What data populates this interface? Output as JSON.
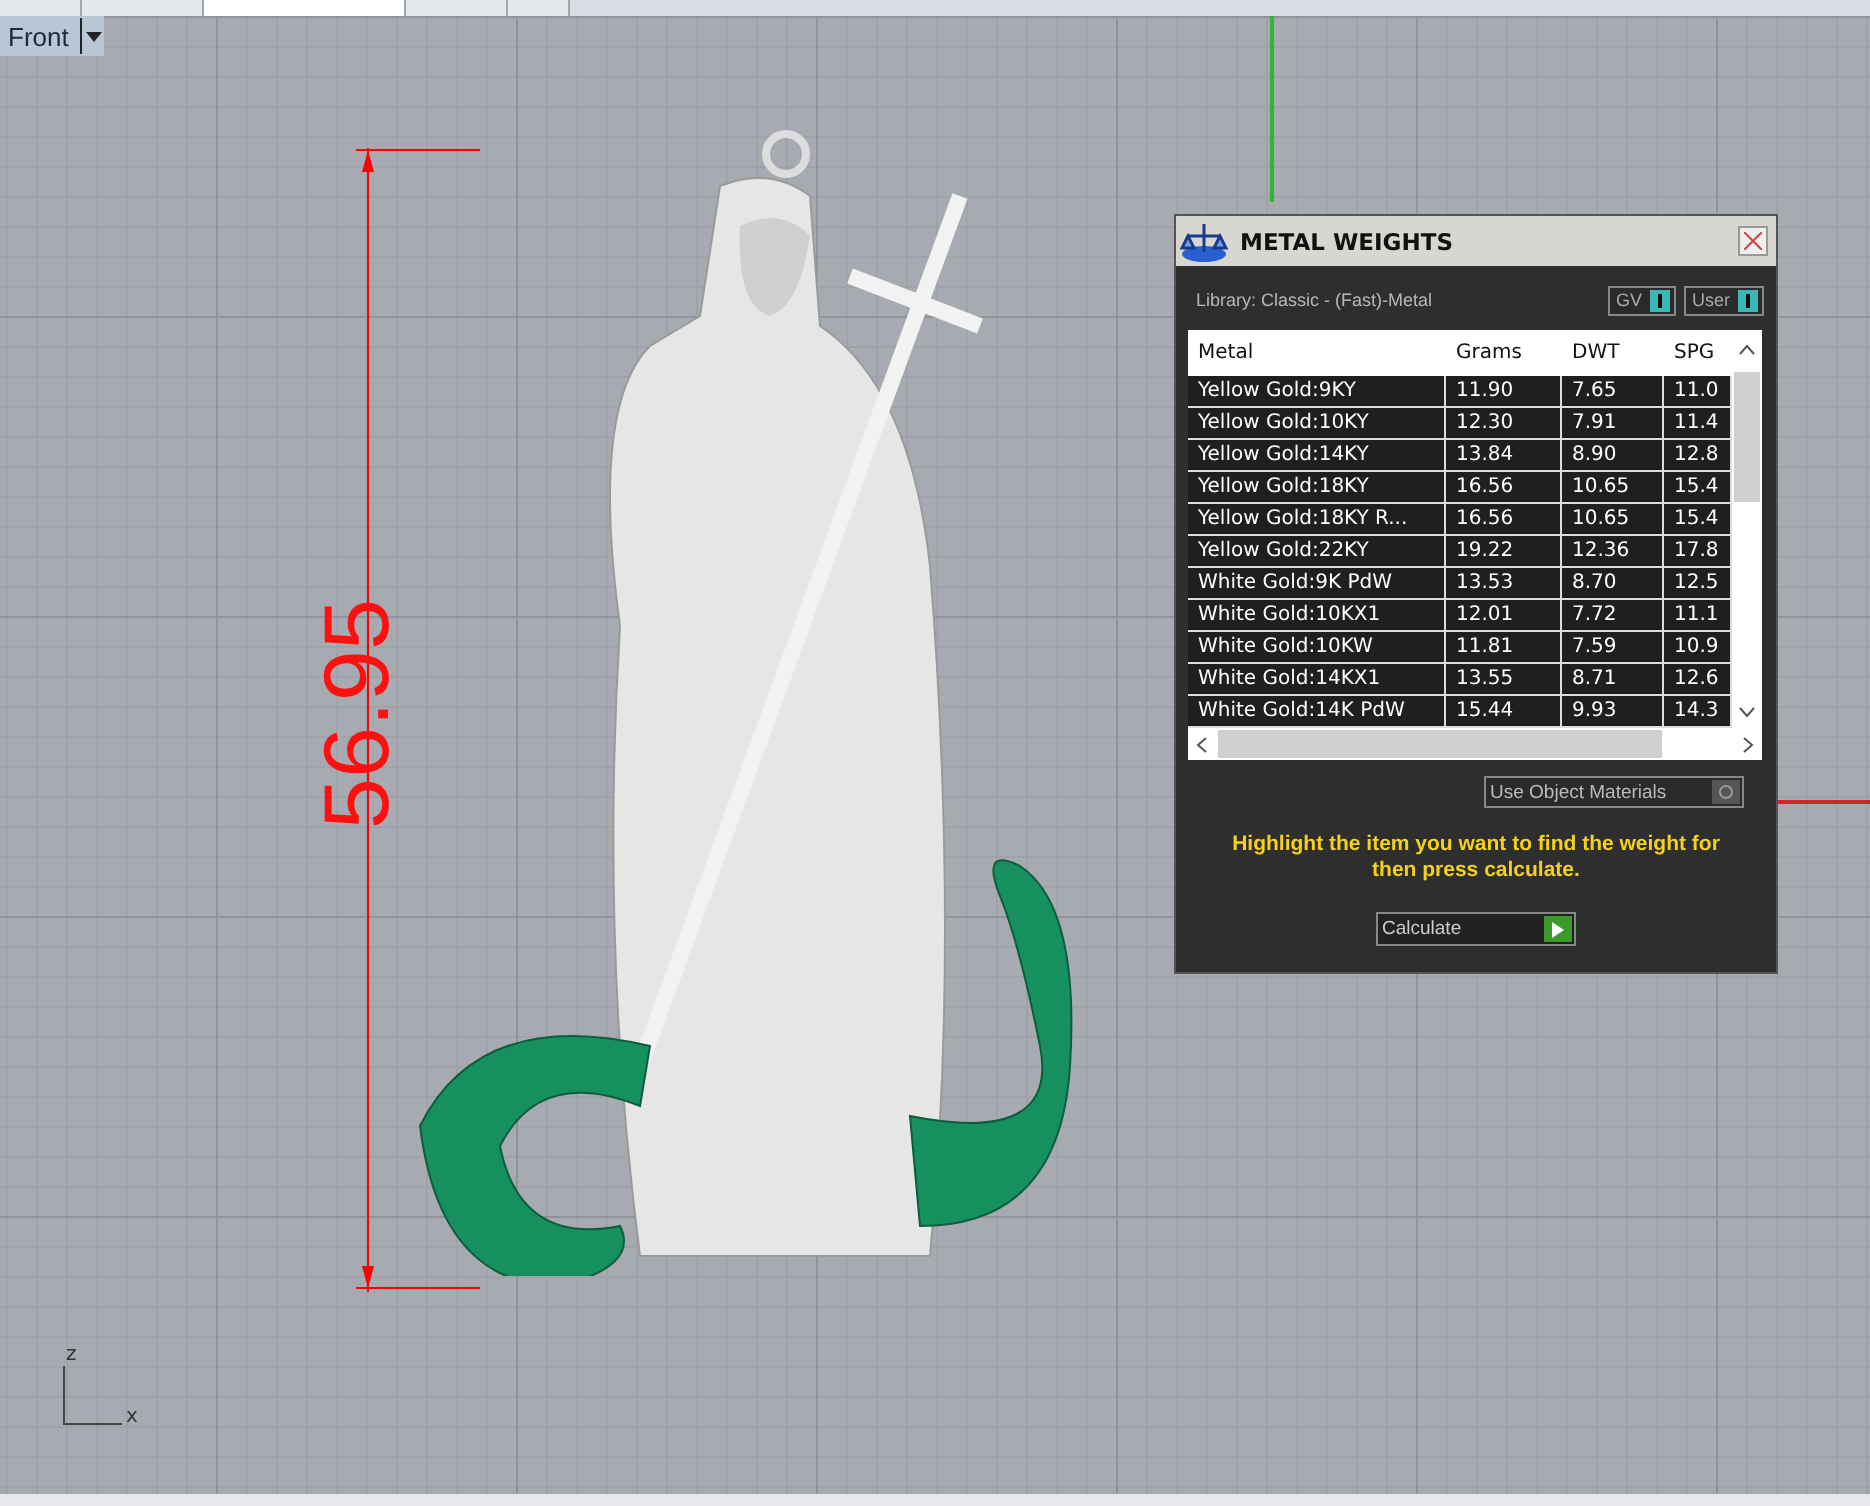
{
  "tabs": [
    {
      "selected": false
    },
    {
      "selected": false
    },
    {
      "selected": true
    },
    {
      "selected": false
    },
    {
      "selected": false
    }
  ],
  "viewport": {
    "title": "Front",
    "dimension": "56.95",
    "axes": {
      "vertical": "z",
      "horizontal": "x"
    }
  },
  "panel": {
    "title": "METAL WEIGHTS",
    "library": "Library: Classic - (Fast)-Metal",
    "toggles": [
      {
        "label": "GV",
        "on": true
      },
      {
        "label": "User",
        "on": true
      }
    ],
    "columns": [
      "Metal",
      "Grams",
      "DWT",
      "SPG"
    ],
    "rows": [
      {
        "cells": [
          "Yellow Gold:9KY",
          "11.90",
          "7.65",
          "11.0"
        ],
        "selected": false
      },
      {
        "cells": [
          "Yellow Gold:10KY",
          "12.30",
          "7.91",
          "11.4"
        ],
        "selected": false
      },
      {
        "cells": [
          "Yellow Gold:14KY",
          "13.84",
          "8.90",
          "12.8"
        ],
        "selected": false
      },
      {
        "cells": [
          "Yellow Gold:18KY",
          "16.56",
          "10.65",
          "15.4"
        ],
        "selected": false
      },
      {
        "cells": [
          "Yellow Gold:18KY R...",
          "16.56",
          "10.65",
          "15.4"
        ],
        "selected": false
      },
      {
        "cells": [
          "Yellow Gold:22KY",
          "19.22",
          "12.36",
          "17.8"
        ],
        "selected": false
      },
      {
        "cells": [
          "White Gold:9K PdW",
          "13.53",
          "8.70",
          "12.5"
        ],
        "selected": false
      },
      {
        "cells": [
          "White Gold:10KX1",
          "12.01",
          "7.72",
          "11.1"
        ],
        "selected": false
      },
      {
        "cells": [
          "White Gold:10KW",
          "11.81",
          "7.59",
          "10.9"
        ],
        "selected": false
      },
      {
        "cells": [
          "White Gold:14KX1",
          "13.55",
          "8.71",
          "12.6"
        ],
        "selected": false
      },
      {
        "cells": [
          "White Gold:14K PdW",
          "15.44",
          "9.93",
          "14.3"
        ],
        "selected": false
      }
    ],
    "materials_toggle": {
      "label": "Use Object Materials",
      "on": false
    },
    "hint": "Highlight the item you want to find the weight for then press calculate.",
    "button": "Calculate"
  }
}
